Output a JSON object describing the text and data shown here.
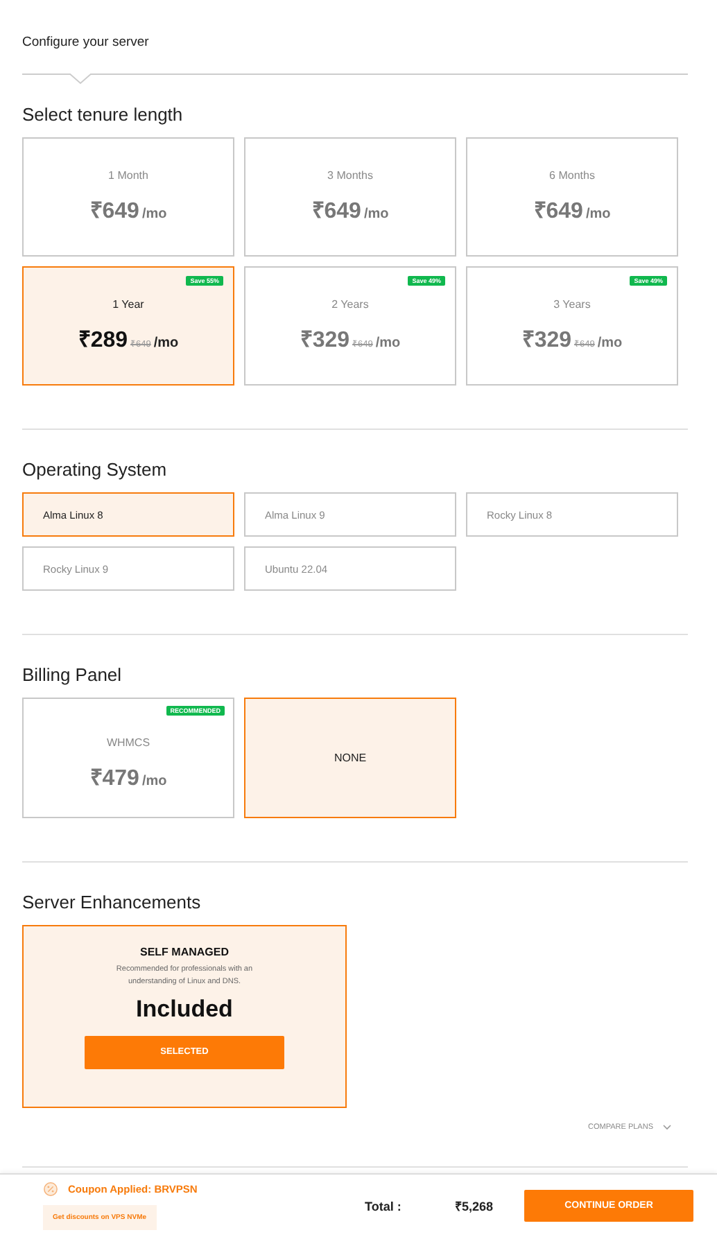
{
  "breadcrumb": "Configure your server",
  "tenure": {
    "title": "Select tenure length",
    "options": [
      {
        "label": "1 Month",
        "price": "₹649",
        "unit": "/mo",
        "selected": false
      },
      {
        "label": "3 Months",
        "price": "₹649",
        "unit": "/mo",
        "selected": false
      },
      {
        "label": "6 Months",
        "price": "₹649",
        "unit": "/mo",
        "selected": false
      },
      {
        "label": "1 Year",
        "price": "₹289",
        "old_price": "₹649",
        "unit": "/mo",
        "badge": "Save 55%",
        "selected": true
      },
      {
        "label": "2 Years",
        "price": "₹329",
        "old_price": "₹649",
        "unit": "/mo",
        "badge": "Save 49%",
        "selected": false
      },
      {
        "label": "3 Years",
        "price": "₹329",
        "old_price": "₹649",
        "unit": "/mo",
        "badge": "Save 49%",
        "selected": false
      }
    ]
  },
  "os": {
    "title": "Operating System",
    "options": [
      {
        "label": "Alma Linux 8",
        "selected": true
      },
      {
        "label": "Alma Linux 9",
        "selected": false
      },
      {
        "label": "Rocky Linux 8",
        "selected": false
      },
      {
        "label": "Rocky Linux 9",
        "selected": false
      },
      {
        "label": "Ubuntu 22.04",
        "selected": false
      }
    ]
  },
  "billing": {
    "title": "Billing Panel",
    "options": [
      {
        "label": "WHMCS",
        "price": "₹479",
        "unit": "/mo",
        "badge": "RECOMMENDED",
        "selected": false
      },
      {
        "label": "NONE",
        "selected": true
      }
    ]
  },
  "enhancements": {
    "title": "Server Enhancements",
    "plans": [
      {
        "name": "SELF MANAGED",
        "description": "Recommended for professionals with an understanding of Linux and DNS.",
        "price": "Included",
        "button": "SELECTED",
        "selected": true
      }
    ],
    "compare": "COMPARE PLANS"
  },
  "footer": {
    "coupon": "Coupon Applied: BRVPSN",
    "coupon_note": "Get discounts on VPS NVMe",
    "total_label": "Total :",
    "total": "₹5,268",
    "button": "CONTINUE ORDER"
  }
}
